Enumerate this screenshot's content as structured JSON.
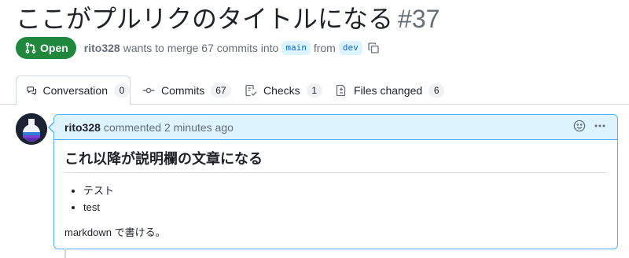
{
  "pr": {
    "title": "ここがプルリクのタイトルになる",
    "number": "#37",
    "state": "Open",
    "author": "rito328",
    "merge_text": "wants to merge 67 commits into",
    "base_branch": "main",
    "from_text": "from",
    "head_branch": "dev"
  },
  "tabs": [
    {
      "label": "Conversation",
      "count": "0"
    },
    {
      "label": "Commits",
      "count": "67"
    },
    {
      "label": "Checks",
      "count": "1"
    },
    {
      "label": "Files changed",
      "count": "6"
    }
  ],
  "comment": {
    "author": "rito328",
    "meta": "commented 2 minutes ago",
    "heading": "これ以降が説明欄の文章になる",
    "list": [
      "テスト",
      "test"
    ],
    "paragraph": "markdown で書ける。"
  },
  "colors": {
    "open_green": "#1f883d",
    "accent_blue": "#0969da",
    "comment_header_bg": "#ddf4ff"
  },
  "icons": {
    "state": "git-pull-request-icon",
    "copy": "copy-icon",
    "conversation": "comment-discussion-icon",
    "commits": "git-commit-icon",
    "checks": "checklist-icon",
    "files": "file-diff-icon",
    "emoji": "smiley-icon",
    "more": "kebab-horizontal-icon"
  }
}
